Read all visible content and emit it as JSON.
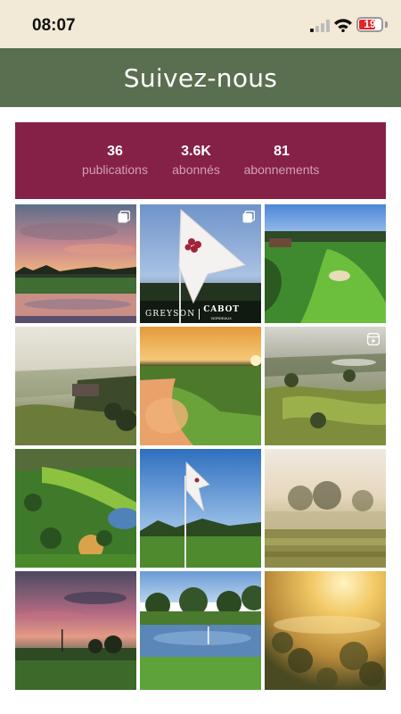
{
  "status_bar": {
    "time": "08:07",
    "battery": "19",
    "battery_level": 0.19,
    "icons": [
      "cellular-signal-icon",
      "wifi-icon",
      "battery-icon"
    ]
  },
  "header": {
    "title": "Suivez-nous"
  },
  "colors": {
    "status_bg": "#f2e9d6",
    "header_bg": "#5a6e50",
    "stats_bg": "#852047",
    "battery_red": "#e0262b"
  },
  "profile_stats": [
    {
      "value": "36",
      "label": "publications"
    },
    {
      "value": "3.6K",
      "label": "abonnés"
    },
    {
      "value": "81",
      "label": "abonnements"
    }
  ],
  "posts": [
    {
      "scene": "sunset-lake",
      "badge": "carousel-icon"
    },
    {
      "scene": "flag-logo",
      "badge": "carousel-icon",
      "overlay_left": "GREYSON",
      "overlay_right": "CABOT",
      "overlay_sub": "BORDEAUX"
    },
    {
      "scene": "course-aerial",
      "badge": ""
    },
    {
      "scene": "misty-clubhouse",
      "badge": ""
    },
    {
      "scene": "golden-green",
      "badge": ""
    },
    {
      "scene": "misty-aerial",
      "badge": "reel-icon"
    },
    {
      "scene": "course-pond",
      "badge": ""
    },
    {
      "scene": "flag-sky",
      "badge": ""
    },
    {
      "scene": "fog-fairway",
      "badge": ""
    },
    {
      "scene": "pink-dusk",
      "badge": ""
    },
    {
      "scene": "pond-green",
      "badge": ""
    },
    {
      "scene": "golden-fog",
      "badge": ""
    }
  ]
}
